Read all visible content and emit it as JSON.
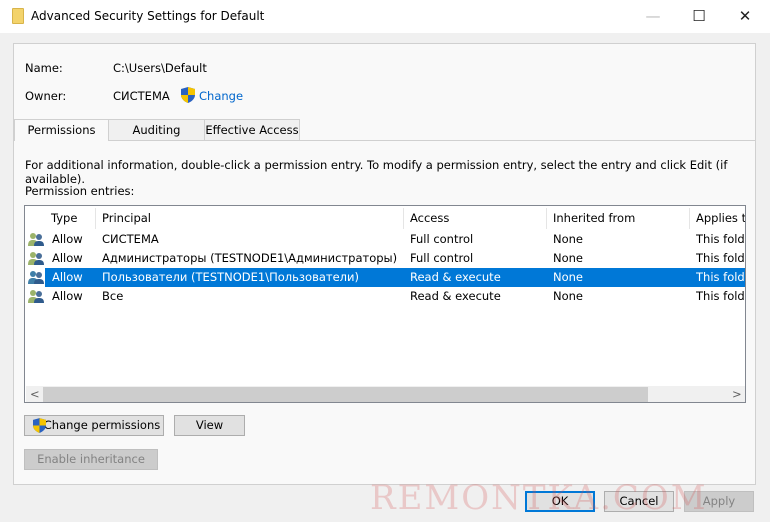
{
  "window": {
    "title": "Advanced Security Settings for Default",
    "minimize": "—",
    "maximize": "☐",
    "close": "✕"
  },
  "info": {
    "name_label": "Name:",
    "name_value": "C:\\Users\\Default",
    "owner_label": "Owner:",
    "owner_value": "СИСТЕМА",
    "change_link": "Change"
  },
  "tabs": [
    {
      "label": "Permissions",
      "active": true
    },
    {
      "label": "Auditing"
    },
    {
      "label": "Effective Access"
    }
  ],
  "instructions": "For additional information, double-click a permission entry. To modify a permission entry, select the entry and click Edit (if available).",
  "entries_label": "Permission entries:",
  "table": {
    "headers": [
      "Type",
      "Principal",
      "Access",
      "Inherited from",
      "Applies to"
    ],
    "rows": [
      {
        "type": "Allow",
        "principal": "СИСТЕМА",
        "access": "Full control",
        "inherited": "None",
        "applies": "This folder",
        "selected": false
      },
      {
        "type": "Allow",
        "principal": "Администраторы (TESTNODE1\\Администраторы)",
        "access": "Full control",
        "inherited": "None",
        "applies": "This folder",
        "selected": false
      },
      {
        "type": "Allow",
        "principal": "Пользователи (TESTNODE1\\Пользователи)",
        "access": "Read & execute",
        "inherited": "None",
        "applies": "This folder",
        "selected": true
      },
      {
        "type": "Allow",
        "principal": "Все",
        "access": "Read & execute",
        "inherited": "None",
        "applies": "This folder",
        "selected": false
      }
    ]
  },
  "buttons": {
    "change_permissions": "Change permissions",
    "view": "View",
    "enable_inheritance": "Enable inheritance",
    "ok": "OK",
    "cancel": "Cancel",
    "apply": "Apply"
  },
  "scroll": {
    "left": "<",
    "right": ">"
  },
  "watermark": "REMONTKA.COM",
  "colors": {
    "selection": "#0078d7",
    "link": "#0066cc"
  }
}
